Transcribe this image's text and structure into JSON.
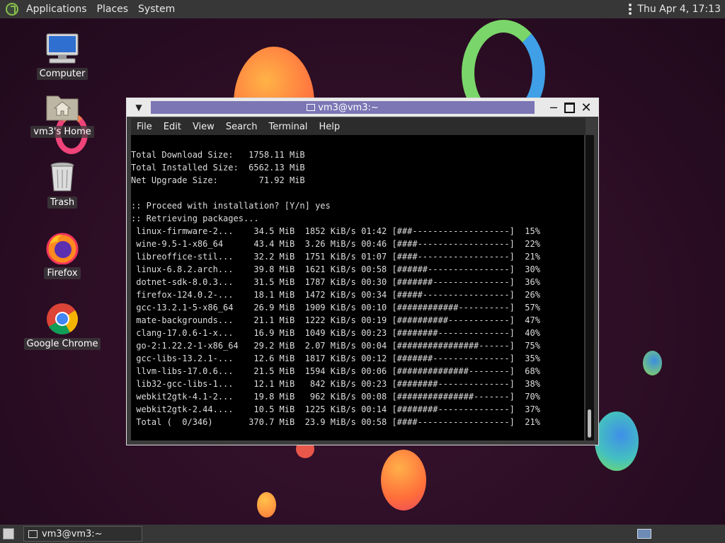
{
  "top_panel": {
    "menus": [
      "Applications",
      "Places",
      "System"
    ],
    "clock": "Thu Apr  4, 17:13"
  },
  "desktop_icons": [
    {
      "label": "Computer",
      "icon": "computer-icon"
    },
    {
      "label": "vm3's Home",
      "icon": "home-folder-icon"
    },
    {
      "label": "Trash",
      "icon": "trash-icon"
    },
    {
      "label": "Firefox",
      "icon": "firefox-icon"
    },
    {
      "label": "Google Chrome",
      "icon": "chrome-icon"
    }
  ],
  "window": {
    "title": "vm3@vm3:~",
    "menu": [
      "File",
      "Edit",
      "View",
      "Search",
      "Terminal",
      "Help"
    ]
  },
  "terminal": {
    "lines": [
      "Total Download Size:   1758.11 MiB",
      "Total Installed Size:  6562.13 MiB",
      "Net Upgrade Size:        71.92 MiB",
      "",
      ":: Proceed with installation? [Y/n] yes",
      ":: Retrieving packages...",
      " linux-firmware-2...    34.5 MiB  1852 KiB/s 01:42 [###-------------------]  15%",
      " wine-9.5-1-x86_64      43.4 MiB  3.26 MiB/s 00:46 [####------------------]  22%",
      " libreoffice-stil...    32.2 MiB  1751 KiB/s 01:07 [####------------------]  21%",
      " linux-6.8.2.arch...    39.8 MiB  1621 KiB/s 00:58 [######----------------]  30%",
      " dotnet-sdk-8.0.3...    31.5 MiB  1787 KiB/s 00:30 [#######---------------]  36%",
      " firefox-124.0.2-...    18.1 MiB  1472 KiB/s 00:34 [#####-----------------]  26%",
      " gcc-13.2.1-5-x86_64    26.9 MiB  1909 KiB/s 00:10 [############----------]  57%",
      " mate-backgrounds...    21.1 MiB  1222 KiB/s 00:19 [##########------------]  47%",
      " clang-17.0.6-1-x...    16.9 MiB  1049 KiB/s 00:23 [########--------------]  40%",
      " go-2:1.22.2-1-x86_64   29.2 MiB  2.07 MiB/s 00:04 [################------]  75%",
      " gcc-libs-13.2.1-...    12.6 MiB  1817 KiB/s 00:12 [#######---------------]  35%",
      " llvm-libs-17.0.6...    21.5 MiB  1594 KiB/s 00:06 [##############--------]  68%",
      " lib32-gcc-libs-1...    12.1 MiB   842 KiB/s 00:23 [########--------------]  38%",
      " webkit2gtk-4.1-2...    19.8 MiB   962 KiB/s 00:08 [###############-------]  70%",
      " webkit2gtk-2.44....    10.5 MiB  1225 KiB/s 00:14 [########--------------]  37%",
      " Total (  0/346)       370.7 MiB  23.9 MiB/s 00:58 [####------------------]  21%"
    ]
  },
  "taskbar": {
    "task_label": "vm3@vm3:~"
  },
  "colors": {
    "desktop_bg": "#2b0d24",
    "panel": "#373737",
    "title_accent": "#7c76b5",
    "terminal_bg": "#000000"
  }
}
